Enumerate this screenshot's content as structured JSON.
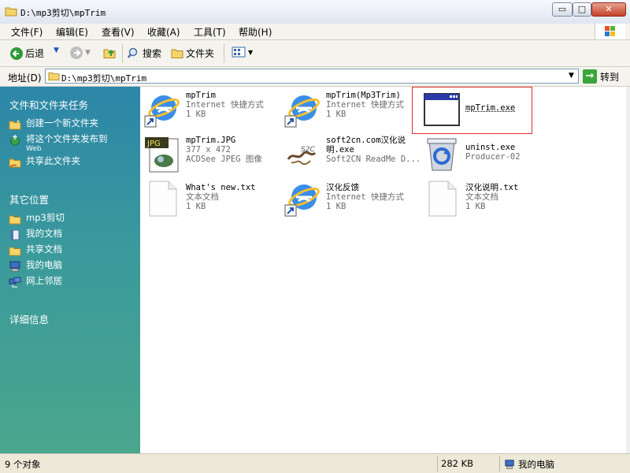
{
  "window": {
    "title": "D:\\mp3剪切\\mpTrim",
    "controls": {
      "minimize": "▭",
      "maximize": "□",
      "close": "✕"
    }
  },
  "menu": [
    "文件(F)",
    "编辑(E)",
    "查看(V)",
    "收藏(A)",
    "工具(T)",
    "帮助(H)"
  ],
  "toolbar": {
    "back": "后退",
    "search": "搜索",
    "folders": "文件夹"
  },
  "address": {
    "label": "地址(D)",
    "value": "D:\\mp3剪切\\mpTrim",
    "go": "转到"
  },
  "left_pane": {
    "file_tasks": {
      "title": "文件和文件夹任务",
      "items": [
        {
          "label": "创建一个新文件夹",
          "icon": "new-folder-icon"
        },
        {
          "label": "将这个文件夹发布到",
          "sub": "Web",
          "icon": "publish-web-icon"
        },
        {
          "label": "共享此文件夹",
          "icon": "share-folder-icon"
        }
      ]
    },
    "other_places": {
      "title": "其它位置",
      "items": [
        {
          "label": "mp3剪切",
          "icon": "folder-icon"
        },
        {
          "label": "我的文档",
          "icon": "my-documents-icon"
        },
        {
          "label": "共享文档",
          "icon": "shared-documents-icon"
        },
        {
          "label": "我的电脑",
          "icon": "my-computer-icon"
        },
        {
          "label": "网上邻居",
          "icon": "network-places-icon"
        }
      ]
    },
    "details": {
      "title": "详细信息"
    }
  },
  "files": [
    {
      "name": "mpTrim",
      "line2": "Internet 快捷方式",
      "line3": "1 KB",
      "icon": "internet-shortcut-icon"
    },
    {
      "name": "mpTrim(Mp3Trim)",
      "line2": "Internet 快捷方式",
      "line3": "1 KB",
      "icon": "internet-shortcut-icon"
    },
    {
      "name": "mpTrim.exe",
      "line2": "",
      "line3": "",
      "icon": "application-window-icon"
    },
    {
      "name": "mpTrim.JPG",
      "line2": "377 x 472",
      "line3": "ACDSee JPEG 图像",
      "icon": "jpeg-image-icon"
    },
    {
      "name": "soft2cn.com汉化说",
      "name2": "明.exe",
      "line2": "Soft2CN ReadMe D...",
      "icon": "soft2cn-dragon-icon"
    },
    {
      "name": "uninst.exe",
      "line2": "Producer-02",
      "line3": "",
      "icon": "recycle-uninstall-icon"
    },
    {
      "name": "What's new.txt",
      "line2": "文本文档",
      "line3": "1 KB",
      "icon": "text-document-icon"
    },
    {
      "name": "汉化反馈",
      "line2": "Internet 快捷方式",
      "line3": "1 KB",
      "icon": "internet-shortcut-icon"
    },
    {
      "name": "汉化说明.txt",
      "line2": "文本文档",
      "line3": "1 KB",
      "icon": "text-document-icon"
    }
  ],
  "status": {
    "count": "9 个对象",
    "size": "282 KB",
    "location": "我的电脑"
  }
}
